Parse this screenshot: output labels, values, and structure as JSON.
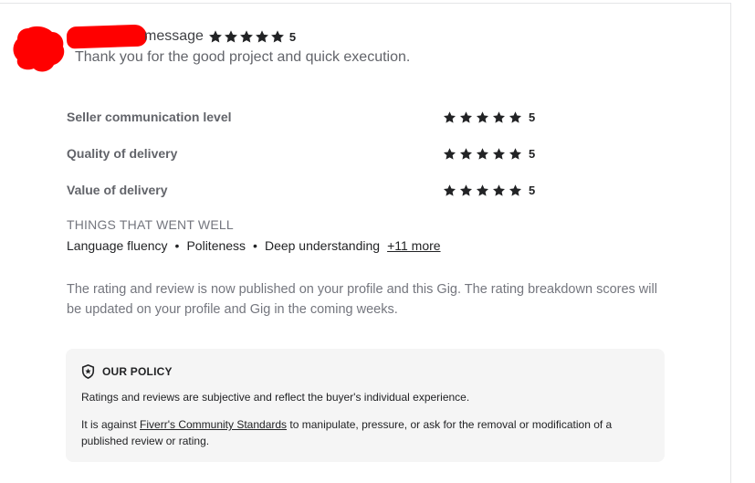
{
  "review": {
    "header_word": "message",
    "overall_score": "5",
    "overall_stars": 5,
    "message": "Thank you for the good project and quick execution."
  },
  "breakdown": [
    {
      "label": "Seller communication level",
      "score": "5",
      "stars": 5
    },
    {
      "label": "Quality of delivery",
      "score": "5",
      "stars": 5
    },
    {
      "label": "Value of delivery",
      "score": "5",
      "stars": 5
    }
  ],
  "went_well": {
    "title": "THINGS THAT WENT WELL",
    "items": [
      "Language fluency",
      "Politeness",
      "Deep understanding"
    ],
    "separator": "•",
    "more_label": "+11 more"
  },
  "notice": "The rating and review is now published on your profile and this Gig. The rating breakdown scores will be updated on your profile and Gig in the coming weeks.",
  "policy": {
    "icon": "shield-icon",
    "title": "OUR POLICY",
    "line1": "Ratings and reviews are subjective and reflect the buyer's individual experience.",
    "line2_before": "It is against ",
    "line2_link": "Fiverr's Community Standards",
    "line2_after": " to manipulate, pressure, or ask for the removal or modification of a published review or rating."
  },
  "colors": {
    "redaction": "#ff0000",
    "star": "#222325",
    "policy_bg": "#f5f5f5"
  }
}
